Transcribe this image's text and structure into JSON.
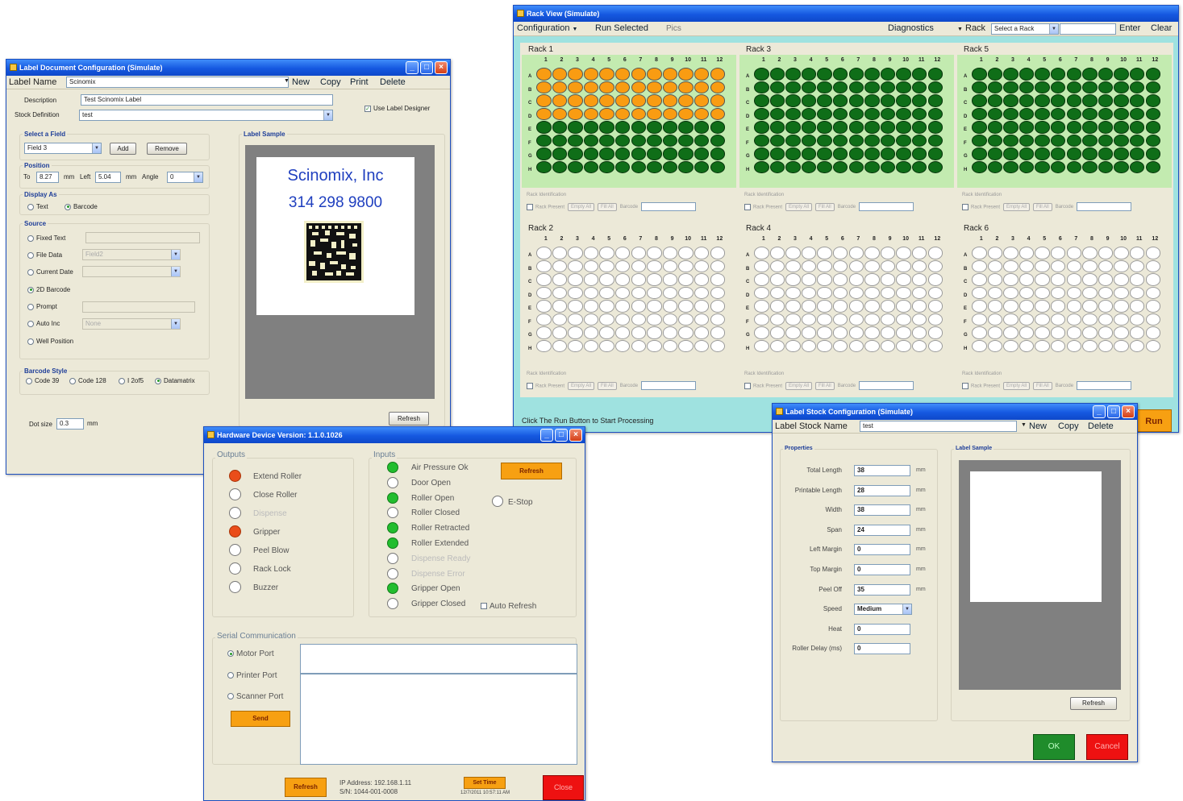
{
  "labelDoc": {
    "title": "Label Document Configuration (Simulate)",
    "labelNameLabel": "Label Name",
    "labelName": "Scinomix",
    "menu": [
      "New",
      "Copy",
      "Print",
      "Delete"
    ],
    "descriptionLabel": "Description",
    "description": "Test Scinomix Label",
    "stockDefinitionLabel": "Stock Definition",
    "stockDefinition": "test",
    "useLabelDesigner": "Use Label Designer",
    "selectFieldTitle": "Select a Field",
    "field": "Field 3",
    "addButton": "Add",
    "removeButton": "Remove",
    "positionTitle": "Position",
    "topLabel": "To",
    "topValue": "8.27",
    "mmTop": "mm",
    "leftLabel": "Left",
    "leftValue": "5.04",
    "mmLeft": "mm",
    "angleLabel": "Angle",
    "angleValue": "0",
    "displayAsTitle": "Display As",
    "displayText": "Text",
    "displayBarcode": "Barcode",
    "sourceTitle": "Source",
    "sourceOptions": [
      "Fixed Text",
      "File Data",
      "Current Date",
      "2D Barcode",
      "Prompt",
      "Auto Inc",
      "Well Position"
    ],
    "fileDataValue": "Field2",
    "autoIncValue": "None",
    "barcodeStyleTitle": "Barcode Style",
    "barcodeStyles": [
      "Code 39",
      "Code 128",
      "I 2of5",
      "Datamatrix"
    ],
    "dotSizeLabel": "Dot size",
    "dotSize": "0.3",
    "dotSizeUnit": "mm",
    "labelSampleTitle": "Label Sample",
    "sampleLine1": "Scinomix, Inc",
    "sampleLine2": "314 298 9800",
    "refreshButton": "Refresh"
  },
  "rackView": {
    "title": "Rack View (Simulate)",
    "menu": {
      "configuration": "Configuration",
      "runSelected": "Run Selected",
      "pics": "Pics",
      "diagnostics": "Diagnostics",
      "rack": "Rack",
      "rackSelect": "Select a Rack",
      "enter": "Enter",
      "clear": "Clear"
    },
    "columns": [
      "1",
      "2",
      "3",
      "4",
      "5",
      "6",
      "7",
      "8",
      "9",
      "10",
      "11",
      "12"
    ],
    "rows": [
      "A",
      "B",
      "C",
      "D",
      "E",
      "F",
      "G",
      "H"
    ],
    "footer": {
      "rackIdentification": "Rack Identification",
      "rackPresent": "Rack Present",
      "emptyAll": "Empty All",
      "fillAll": "Fill All",
      "barcode": "Barcode"
    },
    "racks": [
      {
        "name": "Rack 1",
        "orangeRows": 4,
        "greenRows": 4
      },
      {
        "name": "Rack 3",
        "orangeRows": 0,
        "greenRows": 8
      },
      {
        "name": "Rack 5",
        "orangeRows": 0,
        "greenRows": 8
      },
      {
        "name": "Rack 2",
        "orangeRows": 0,
        "greenRows": 0
      },
      {
        "name": "Rack 4",
        "orangeRows": 0,
        "greenRows": 0
      },
      {
        "name": "Rack 6",
        "orangeRows": 0,
        "greenRows": 0
      }
    ],
    "status": "Click The Run Button to Start Processing",
    "runButton": "Run"
  },
  "hardware": {
    "title": "Hardware Device Version: 1.1.0.1026",
    "outputsTitle": "Outputs",
    "outputs": [
      {
        "label": "Extend Roller",
        "state": "red"
      },
      {
        "label": "Close Roller",
        "state": "off"
      },
      {
        "label": "Dispense",
        "state": "off",
        "disabled": true
      },
      {
        "label": "Gripper",
        "state": "red"
      },
      {
        "label": "Peel Blow",
        "state": "off"
      },
      {
        "label": "Rack Lock",
        "state": "off"
      },
      {
        "label": "Buzzer",
        "state": "off"
      }
    ],
    "inputsTitle": "Inputs",
    "inputs": [
      {
        "label": "Air Pressure Ok",
        "state": "green"
      },
      {
        "label": "Door Open",
        "state": "off"
      },
      {
        "label": "Roller Open",
        "state": "green"
      },
      {
        "label": "Roller Closed",
        "state": "off"
      },
      {
        "label": "Roller Retracted",
        "state": "green"
      },
      {
        "label": "Roller Extended",
        "state": "green"
      },
      {
        "label": "Dispense Ready",
        "state": "off",
        "disabled": true
      },
      {
        "label": "Dispense Error",
        "state": "off",
        "disabled": true
      },
      {
        "label": "Gripper Open",
        "state": "green"
      },
      {
        "label": "Gripper Closed",
        "state": "off"
      }
    ],
    "refreshInputs": "Refresh",
    "estop": "E-Stop",
    "autoRefresh": "Auto Refresh",
    "serialTitle": "Serial Communication",
    "ports": [
      "Motor Port",
      "Printer Port",
      "Scanner Port"
    ],
    "sendButton": "Send",
    "refreshButton": "Refresh",
    "ipAddress": "IP Address: 192.168.1.11",
    "serial": "S/N: 1044-001-0008",
    "setTimeButton": "Set Time",
    "dateTime": "12/7/2011 10:57:11 AM",
    "closeButton": "Close"
  },
  "labelStock": {
    "title": "Label Stock Configuration (Simulate)",
    "nameLabel": "Label Stock Name",
    "name": "test",
    "menu": [
      "New",
      "Copy",
      "Delete"
    ],
    "propertiesTitle": "Properties",
    "fields": [
      {
        "label": "Total Length",
        "value": "38",
        "unit": "mm"
      },
      {
        "label": "Printable Length",
        "value": "28",
        "unit": "mm"
      },
      {
        "label": "Width",
        "value": "38",
        "unit": "mm"
      },
      {
        "label": "Span",
        "value": "24",
        "unit": "mm"
      },
      {
        "label": "Left Margin",
        "value": "0",
        "unit": "mm"
      },
      {
        "label": "Top Margin",
        "value": "0",
        "unit": "mm"
      },
      {
        "label": "Peel Off",
        "value": "35",
        "unit": "mm"
      },
      {
        "label": "Speed",
        "value": "Medium",
        "unit": ""
      },
      {
        "label": "Heat",
        "value": "0",
        "unit": ""
      },
      {
        "label": "Roller Delay (ms)",
        "value": "0",
        "unit": ""
      }
    ],
    "labelSampleTitle": "Label Sample",
    "refreshButton": "Refresh",
    "okButton": "OK",
    "cancelButton": "Cancel"
  }
}
